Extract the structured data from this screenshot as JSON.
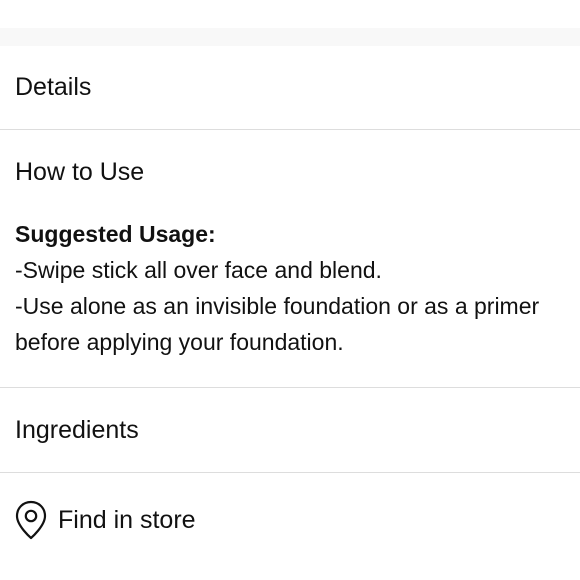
{
  "sections": {
    "details": {
      "label": "Details"
    },
    "how_to_use": {
      "label": "How to Use",
      "content": {
        "heading": "Suggested Usage:",
        "lines": [
          "-Swipe stick all over face and blend.",
          "-Use alone as an invisible foundation or as a primer",
          "before applying your foundation."
        ]
      }
    },
    "ingredients": {
      "label": "Ingredients"
    },
    "find_in_store": {
      "label": "Find in store",
      "icon": "location-pin-icon"
    }
  },
  "colors": {
    "text": "#111111",
    "divider": "#dddddd",
    "top_strip": "#f8f8f8"
  }
}
